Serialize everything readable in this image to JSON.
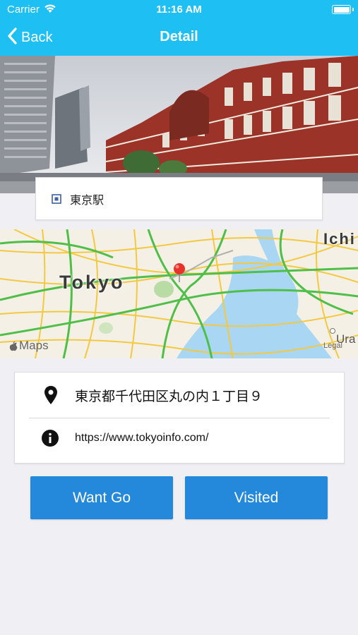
{
  "status_bar": {
    "carrier": "Carrier",
    "time": "11:16 AM"
  },
  "nav": {
    "back_label": "Back",
    "title": "Detail"
  },
  "station": {
    "name": "東京駅"
  },
  "map": {
    "city_label": "Tokyo",
    "edge_label": "Ichi",
    "edge_label_2": "Ura",
    "maps_brand": "Maps",
    "legal": "Legal"
  },
  "info": {
    "address": "東京都千代田区丸の内１丁目９",
    "url": "https://www.tokyoinfo.com/"
  },
  "actions": {
    "want_go": "Want Go",
    "visited": "Visited"
  },
  "colors": {
    "header": "#1ec0f4",
    "button": "#2488db",
    "background": "#efeff4",
    "pin": "#e8332a"
  }
}
